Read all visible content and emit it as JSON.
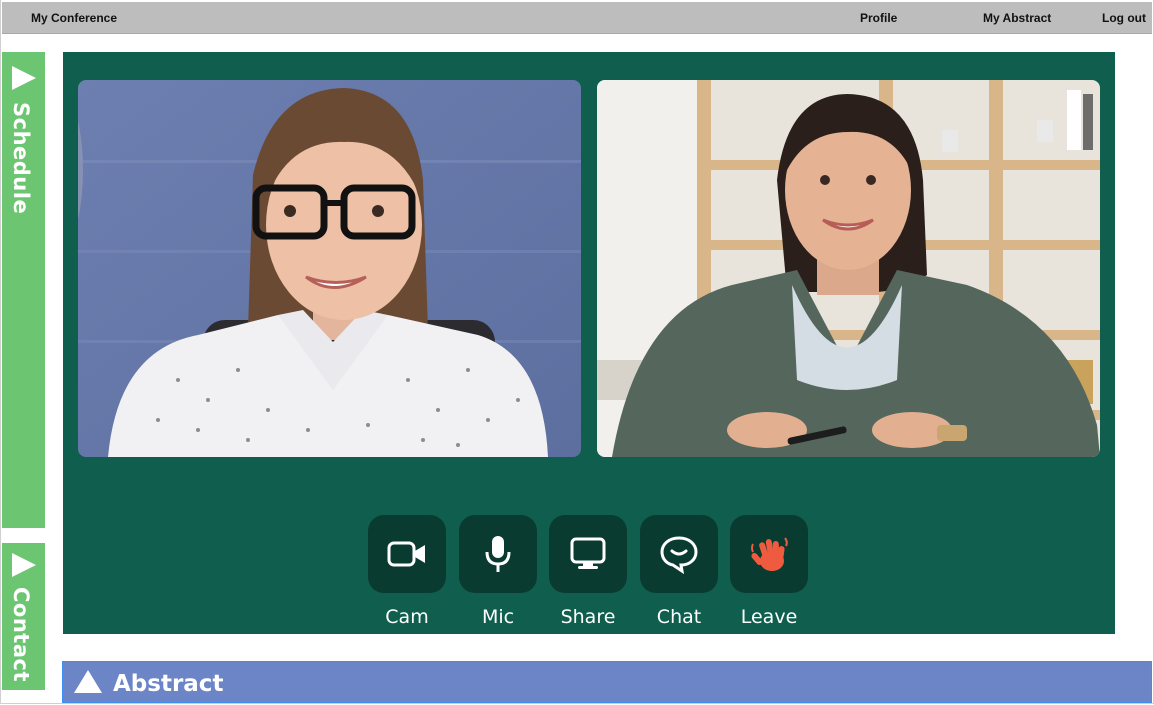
{
  "topbar": {
    "brand": "My Conference",
    "profile": "Profile",
    "my_abstract": "My Abstract",
    "logout": "Log out"
  },
  "sidebar": {
    "schedule": "Schedule",
    "contact": "Contact"
  },
  "controls": {
    "cam": "Cam",
    "mic": "Mic",
    "share": "Share",
    "chat": "Chat",
    "leave": "Leave"
  },
  "abstract_panel": {
    "title": "Abstract"
  },
  "colors": {
    "topbar_bg": "#bdbdbd",
    "sidebar_green": "#6cc571",
    "stage_bg": "#0f5e4e",
    "control_bg": "#0a3b31",
    "leave_icon": "#ef5b3f",
    "abstract_bg": "#6b85c7"
  },
  "icons": {
    "cam": "video-camera-icon",
    "mic": "microphone-icon",
    "share": "screen-share-icon",
    "chat": "chat-bubble-icon",
    "leave": "waving-hand-icon"
  }
}
